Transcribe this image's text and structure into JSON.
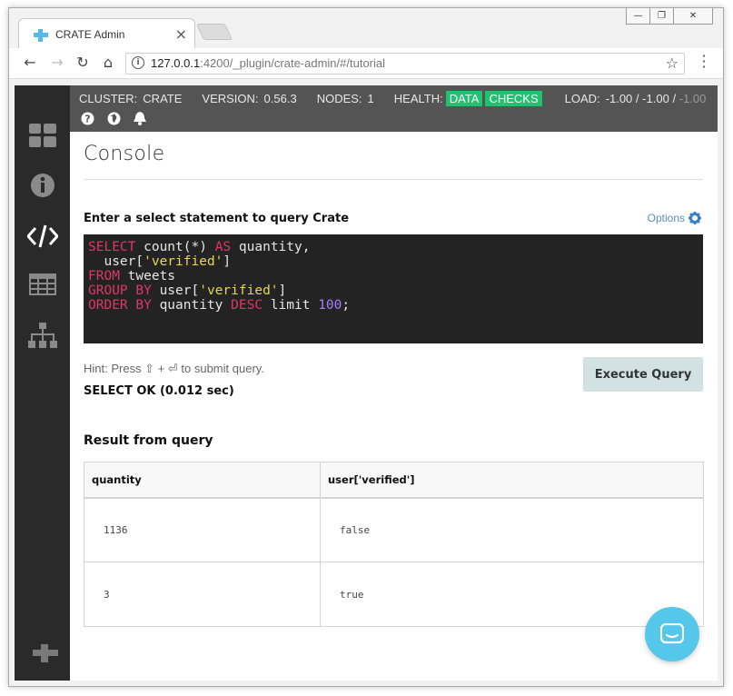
{
  "browser": {
    "tab_title": "CRATE Admin",
    "tab_close": "×",
    "url_host": "127.0.0.1",
    "url_path": ":4200/_plugin/crate-admin/#/tutorial",
    "window_controls": [
      "—",
      "❐",
      "✕"
    ]
  },
  "header": {
    "cluster_label": "CLUSTER:",
    "cluster_value": "CRATE",
    "version_label": "VERSION:",
    "version_value": "0.56.3",
    "nodes_label": "NODES:",
    "nodes_value": "1",
    "health_label": "HEALTH:",
    "health_data": "DATA",
    "health_checks": "CHECKS",
    "load_label": "LOAD:",
    "load_1": "-1.00",
    "load_sep1": "/",
    "load_5": "-1.00",
    "load_sep2": "/",
    "load_15": "-1.00"
  },
  "sidebar": {
    "items": [
      "overview",
      "cluster-info",
      "console",
      "tables",
      "nodes"
    ]
  },
  "console": {
    "title": "Console",
    "query_label": "Enter a select statement to query Crate",
    "options_label": "Options",
    "hint": "Hint: Press ⇧ + ⏎ to submit query.",
    "status": "SELECT OK (0.012 sec)",
    "execute_label": "Execute Query",
    "result_label": "Result from query"
  },
  "query": {
    "l1_kw1": "SELECT",
    "l1_t1": " count(*) ",
    "l1_kw2": "AS",
    "l1_t2": " quantity,",
    "l2_t1": "  user[",
    "l2_str": "'verified'",
    "l2_t2": "]",
    "l3_kw": "FROM",
    "l3_t": " tweets",
    "l4_kw": "GROUP BY",
    "l4_t1": " user[",
    "l4_str": "'verified'",
    "l4_t2": "]",
    "l5_kw1": "ORDER BY",
    "l5_t1": " quantity ",
    "l5_kw2": "DESC",
    "l5_t2": " limit ",
    "l5_num": "100",
    "l5_t3": ";"
  },
  "results": {
    "columns": [
      "quantity",
      "user['verified']"
    ],
    "rows": [
      [
        "1136",
        "false"
      ],
      [
        "3",
        "true"
      ]
    ]
  },
  "colors": {
    "sidebar": "#2a2a2a",
    "topbar": "#545454",
    "health_ok": "#1ec36f",
    "keyword": "#e3336b",
    "string": "#e5d84d",
    "number": "#a97dff",
    "chat": "#55c7ea"
  }
}
